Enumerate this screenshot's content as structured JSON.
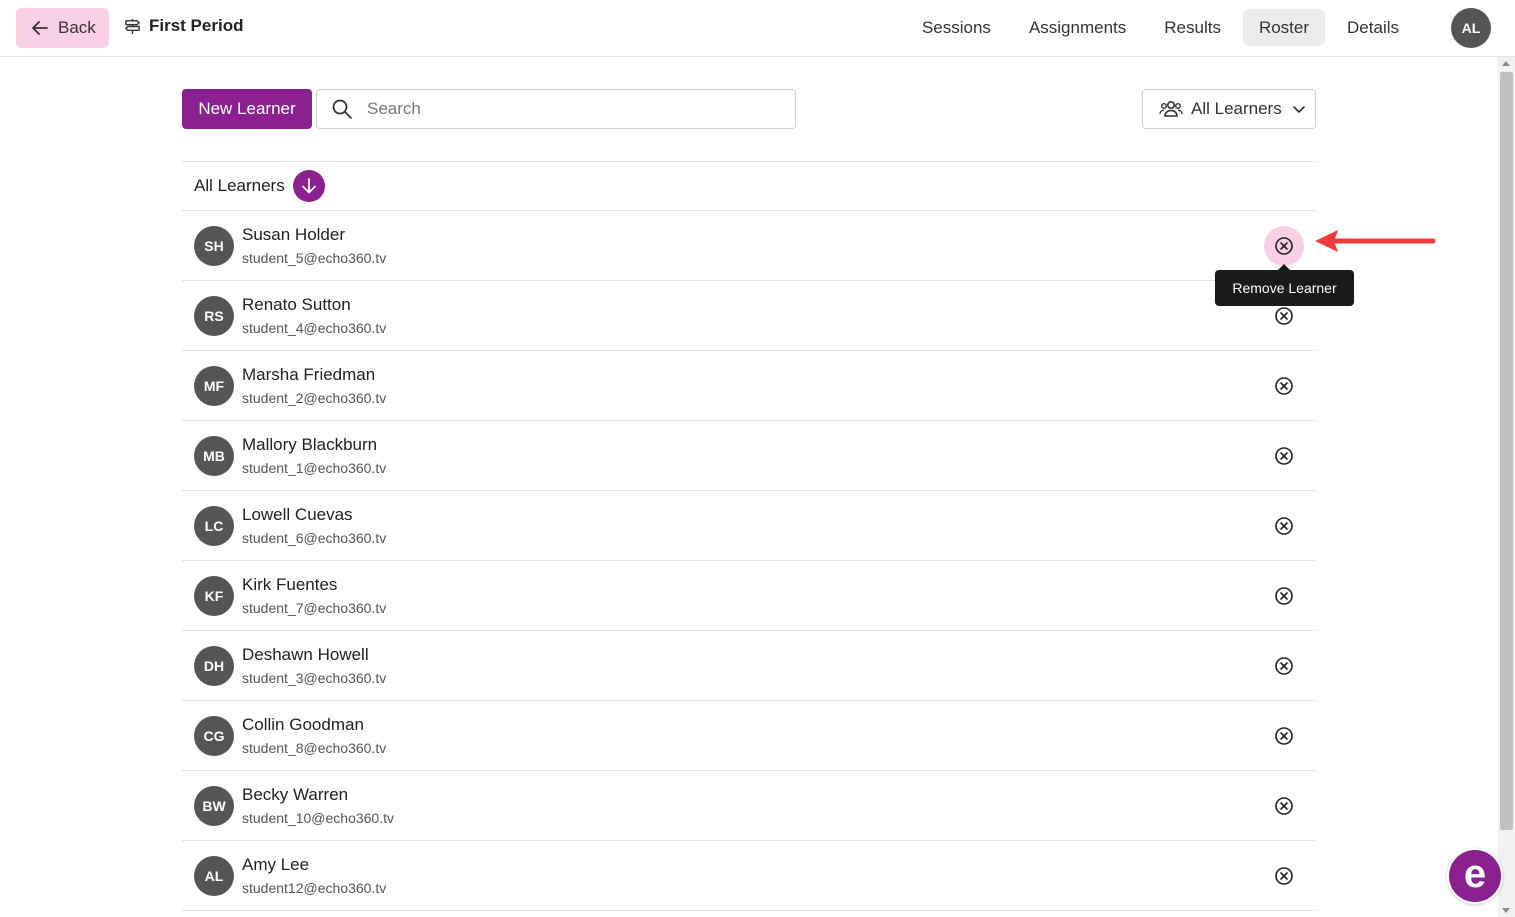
{
  "header": {
    "back_label": "Back",
    "course_title": "First Period",
    "nav": [
      {
        "label": "Sessions",
        "active": false
      },
      {
        "label": "Assignments",
        "active": false
      },
      {
        "label": "Results",
        "active": false
      },
      {
        "label": "Roster",
        "active": true
      },
      {
        "label": "Details",
        "active": false
      }
    ],
    "user_initials": "AL"
  },
  "toolbar": {
    "new_learner_label": "New Learner",
    "search_placeholder": "Search",
    "search_value": "",
    "filter_label": "All Learners"
  },
  "list": {
    "header_label": "All Learners",
    "rows": [
      {
        "initials": "SH",
        "name": "Susan Holder",
        "email": "student_5@echo360.tv"
      },
      {
        "initials": "RS",
        "name": "Renato Sutton",
        "email": "student_4@echo360.tv"
      },
      {
        "initials": "MF",
        "name": "Marsha Friedman",
        "email": "student_2@echo360.tv"
      },
      {
        "initials": "MB",
        "name": "Mallory Blackburn",
        "email": "student_1@echo360.tv"
      },
      {
        "initials": "LC",
        "name": "Lowell Cuevas",
        "email": "student_6@echo360.tv"
      },
      {
        "initials": "KF",
        "name": "Kirk Fuentes",
        "email": "student_7@echo360.tv"
      },
      {
        "initials": "DH",
        "name": "Deshawn Howell",
        "email": "student_3@echo360.tv"
      },
      {
        "initials": "CG",
        "name": "Collin Goodman",
        "email": "student_8@echo360.tv"
      },
      {
        "initials": "BW",
        "name": "Becky Warren",
        "email": "student_10@echo360.tv"
      },
      {
        "initials": "AL",
        "name": "Amy Lee",
        "email": "student12@echo360.tv"
      }
    ]
  },
  "tooltip": {
    "text": "Remove Learner"
  },
  "help": {
    "glyph": "e"
  },
  "colors": {
    "accent": "#8b2191",
    "back_bg": "#f9cfe6",
    "avatar_bg": "#555555",
    "annotation_arrow": "#ee3b3b"
  }
}
